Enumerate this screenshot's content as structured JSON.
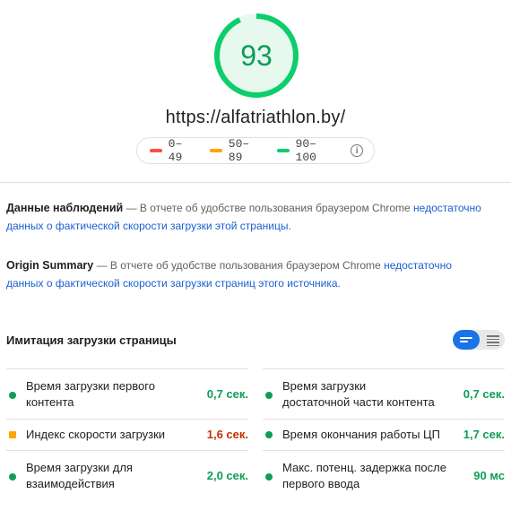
{
  "score": {
    "value": "93",
    "fraction": 0.93,
    "color": "#0cce6b"
  },
  "url": "https://alfatriathlon.by/",
  "legend": {
    "items": [
      {
        "label": "0–49",
        "color": "#ff4e42"
      },
      {
        "label": "50–89",
        "color": "#ffa400"
      },
      {
        "label": "90–100",
        "color": "#0cce6b"
      }
    ],
    "info_icon": "info-icon"
  },
  "field_data": {
    "title": "Данные наблюдений",
    "dash": " — ",
    "text": "В отчете об удобстве пользования браузером Chrome ",
    "link": "недостаточно данных о фактической скорости загрузки этой страницы",
    "end": "."
  },
  "origin_summary": {
    "title": "Origin Summary",
    "dash": " — ",
    "text": "В отчете об удобстве пользования браузером Chrome ",
    "link": "недостаточно данных о фактической скорости загрузки страниц этого источника",
    "end": "."
  },
  "lab": {
    "title": "Имитация загрузки страницы",
    "toggle": {
      "active": "view-compact",
      "inactive": "view-expanded"
    }
  },
  "metrics_left": [
    {
      "label": "Время загрузки первого контента",
      "value": "0,7 сек.",
      "status": "good"
    },
    {
      "label": "Индекс скорости загрузки",
      "value": "1,6 сек.",
      "status": "average"
    },
    {
      "label": "Время загрузки для взаимодействия",
      "value": "2,0 сек.",
      "status": "good"
    }
  ],
  "metrics_right": [
    {
      "label": "Время загрузки достаточной части контента",
      "value": "0,7 сек.",
      "status": "good"
    },
    {
      "label": "Время окончания работы ЦП",
      "value": "1,7 сек.",
      "status": "good"
    },
    {
      "label": "Макс. потенц. задержка после первого ввода",
      "value": "90 мс",
      "status": "good"
    }
  ],
  "colors": {
    "good": "#0c9d57",
    "average": "#c33300",
    "link": "#1a5fd0",
    "toggle_active": "#1a73e8"
  }
}
